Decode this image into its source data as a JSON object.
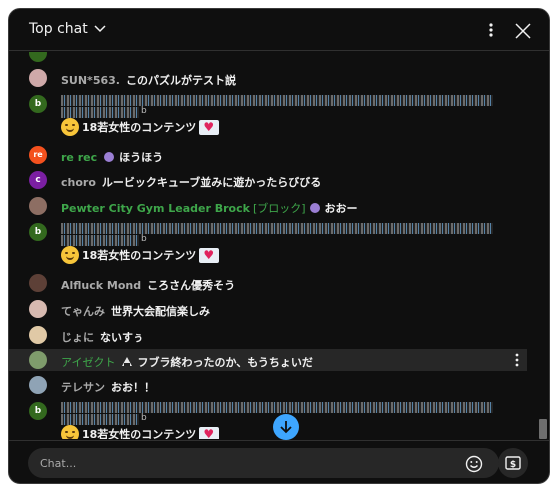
{
  "header": {
    "title": "Top chat"
  },
  "messages": [
    {
      "author": "SUN*563.",
      "text": "このパズルがテスト説",
      "avatar_letter": "",
      "avatar_color": "#cfa9a9"
    },
    {
      "author": "b",
      "text": "18若女性のコンテンツ",
      "avatar_letter": "b",
      "avatar_color": "#33691e",
      "tail": "b"
    },
    {
      "author": "re rec",
      "text": "ほうほう",
      "avatar_letter": "re",
      "avatar_color": "#f4511e"
    },
    {
      "author": "choro",
      "text": "ルービックキューブ並みに遊かったらびびる",
      "avatar_letter": "c",
      "avatar_color": "#7b1fa2"
    },
    {
      "author": "Pewter City Gym Leader Brock",
      "author_tag": "[ブロック]",
      "text": "おおー",
      "avatar_letter": "",
      "avatar_color": "#8d6e63"
    },
    {
      "author": "b",
      "text": "18若女性のコンテンツ",
      "avatar_letter": "b",
      "avatar_color": "#33691e",
      "tail": "b"
    },
    {
      "author": "Alfluck Mond",
      "text": "ころさん優秀そう",
      "avatar_letter": "",
      "avatar_color": "#5d4037"
    },
    {
      "author": "てゃんみ",
      "text": "世界大会配信楽しみ",
      "avatar_letter": "",
      "avatar_color": "#d7b9b0"
    },
    {
      "author": "じょに",
      "text": "ないすぅ",
      "avatar_letter": "",
      "avatar_color": "#e0c9a6"
    },
    {
      "author": "アイゼクト",
      "text": "フブラ終わったのか、もうちょいだ",
      "avatar_letter": "",
      "avatar_color": "#7f9c6c"
    },
    {
      "author": "テレサン",
      "text": "おお！！",
      "avatar_letter": "",
      "avatar_color": "#8fa3b5"
    },
    {
      "author": "b",
      "text": "18若女性のコンテンツ",
      "avatar_letter": "b",
      "avatar_color": "#33691e",
      "tail": "b"
    }
  ],
  "input": {
    "placeholder": "Chat..."
  },
  "icons": {
    "dropdown": "chevron-down-icon",
    "menu": "more-vert-icon",
    "close": "close-icon",
    "scroll": "arrow-down-icon",
    "emoji": "emoji-icon",
    "super_chat": "super-chat-icon"
  },
  "colors": {
    "accent": "#3ea6ff",
    "member_green": "#3ea64a",
    "background": "#0f0f0f"
  }
}
